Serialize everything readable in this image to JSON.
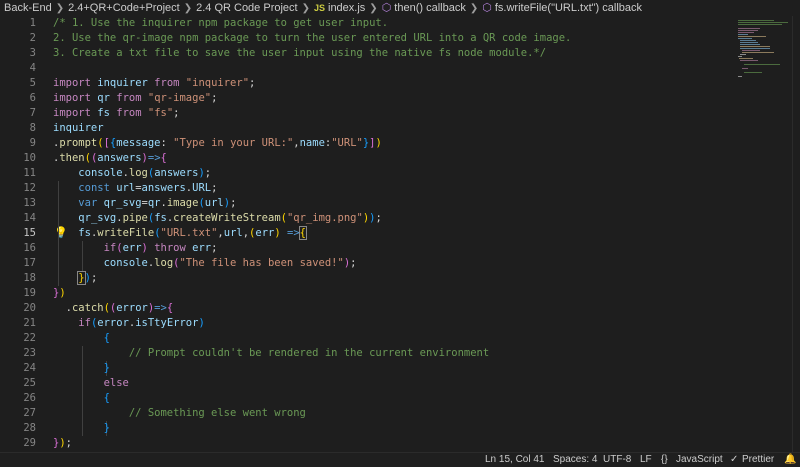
{
  "breadcrumb": {
    "items": [
      "Back-End",
      "2.4+QR+Code+Project",
      "2.4 QR Code Project",
      "index.js",
      "then() callback",
      "fs.writeFile(\"URL.txt\") callback"
    ],
    "file_badge": "JS"
  },
  "editor": {
    "language": "javascript",
    "active_line": 15,
    "line_numbers": [
      "1",
      "2",
      "3",
      "4",
      "5",
      "6",
      "7",
      "8",
      "9",
      "10",
      "11",
      "12",
      "13",
      "14",
      "15",
      "16",
      "17",
      "18",
      "19",
      "20",
      "21",
      "22",
      "23",
      "24",
      "25",
      "26",
      "27",
      "28",
      "29"
    ]
  },
  "status_bar": {
    "position": "Ln 15, Col 41",
    "spaces": "Spaces: 4",
    "encoding": "UTF-8",
    "eol": "LF",
    "language": "JavaScript",
    "prettier": "Prettier"
  },
  "icons": {
    "lightbulb": "lightbulb-icon",
    "symbol_method": "symbol-method-icon",
    "notifications": "bell-icon"
  }
}
